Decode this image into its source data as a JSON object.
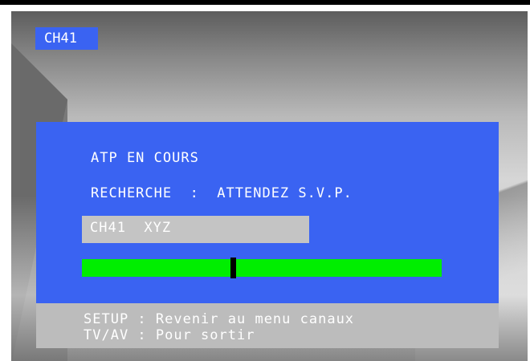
{
  "channel_badge": "CH41",
  "menu": {
    "title": "ATP EN COURS",
    "status": "RECHERCHE  :  ATTENDEZ S.V.P.",
    "selected_channel": "CH41  XYZ",
    "progress_percent": 42
  },
  "footer": {
    "line1": "SETUP : Revenir au menu canaux",
    "line2": "TV/AV : Pour sortir"
  },
  "colors": {
    "panel_blue": "#3a63f2",
    "progress_green": "#00ee00",
    "footer_gray": "#bcbcbc"
  }
}
